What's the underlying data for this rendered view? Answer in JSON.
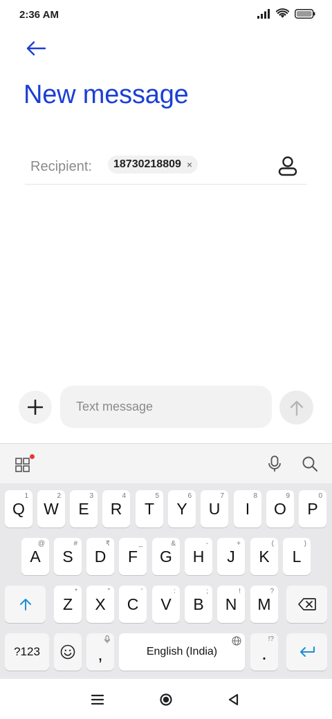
{
  "status_bar": {
    "time": "2:36 AM"
  },
  "header": {
    "title": "New message"
  },
  "recipient": {
    "label": "Recipient:",
    "chip_number": "18730218809",
    "chip_remove_glyph": "×"
  },
  "compose": {
    "placeholder": "Text message"
  },
  "keyboard": {
    "row1": [
      {
        "label": "Q",
        "hint": "1"
      },
      {
        "label": "W",
        "hint": "2"
      },
      {
        "label": "E",
        "hint": "3"
      },
      {
        "label": "R",
        "hint": "4"
      },
      {
        "label": "T",
        "hint": "5"
      },
      {
        "label": "Y",
        "hint": "6"
      },
      {
        "label": "U",
        "hint": "7"
      },
      {
        "label": "I",
        "hint": "8"
      },
      {
        "label": "O",
        "hint": "9"
      },
      {
        "label": "P",
        "hint": "0"
      }
    ],
    "row2": [
      {
        "label": "A",
        "hint": "@"
      },
      {
        "label": "S",
        "hint": "#"
      },
      {
        "label": "D",
        "hint": "₹"
      },
      {
        "label": "F",
        "hint": "_"
      },
      {
        "label": "G",
        "hint": "&"
      },
      {
        "label": "H",
        "hint": "-"
      },
      {
        "label": "J",
        "hint": "+"
      },
      {
        "label": "K",
        "hint": "("
      },
      {
        "label": "L",
        "hint": ")"
      }
    ],
    "row3": [
      {
        "label": "Z",
        "hint": "*"
      },
      {
        "label": "X",
        "hint": "\""
      },
      {
        "label": "C",
        "hint": "'"
      },
      {
        "label": "V",
        "hint": ":"
      },
      {
        "label": "B",
        "hint": ";"
      },
      {
        "label": "N",
        "hint": "!"
      },
      {
        "label": "M",
        "hint": "?"
      }
    ],
    "symbols_label": "?123",
    "comma_label": ",",
    "space_label": "English (India)",
    "period_label": ".",
    "period_hint": "!?"
  },
  "colors": {
    "accent": "#1a3fd6",
    "keyboard_accent": "#1a8fd6",
    "notification_dot": "#e53935"
  },
  "icons": {
    "back": "arrow-left-icon",
    "contact": "person-icon",
    "attach": "plus-icon",
    "send": "arrow-up-icon",
    "apps": "grid-icon",
    "mic": "mic-icon",
    "search": "search-icon",
    "shift": "shift-icon",
    "backspace": "backspace-icon",
    "emoji": "emoji-icon",
    "enter": "enter-icon",
    "globe": "globe-icon"
  }
}
